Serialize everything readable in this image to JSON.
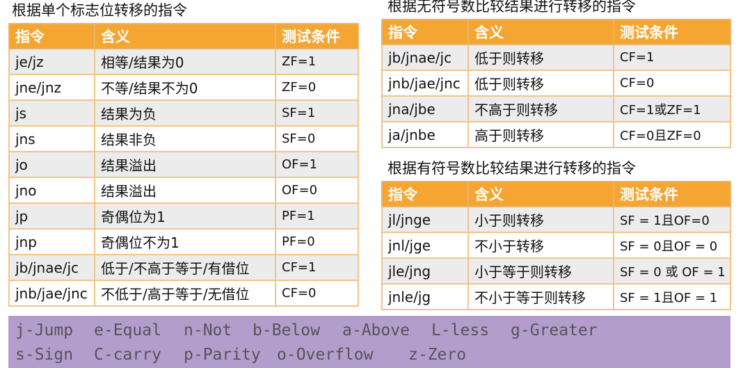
{
  "left": {
    "title": "根据单个标志位转移的指令",
    "headers": [
      "指令",
      "含义",
      "测试条件"
    ],
    "rows": [
      [
        "je/jz",
        "相等/结果为0",
        "ZF=1"
      ],
      [
        "jne/jnz",
        "不等/结果不为0",
        "ZF=0"
      ],
      [
        "js",
        "结果为负",
        "SF=1"
      ],
      [
        "jns",
        "结果非负",
        "SF=0"
      ],
      [
        "jo",
        "结果溢出",
        "OF=1"
      ],
      [
        "jno",
        "结果溢出",
        "OF=0"
      ],
      [
        "jp",
        "奇偶位为1",
        "PF=1"
      ],
      [
        "jnp",
        "奇偶位不为1",
        "PF=0"
      ],
      [
        "jb/jnae/jc",
        "低于/不高于等于/有借位",
        "CF=1"
      ],
      [
        "jnb/jae/jnc",
        "不低于/高于等于/无借位",
        "CF=0"
      ]
    ]
  },
  "unsigned": {
    "title": "根据无符号数比较结果进行转移的指令",
    "headers": [
      "指令",
      "含义",
      "测试条件"
    ],
    "rows": [
      [
        "jb/jnae/jc",
        "低于则转移",
        "CF=1"
      ],
      [
        "jnb/jae/jnc",
        "低于则转移",
        "CF=0"
      ],
      [
        "jna/jbe",
        "不高于则转移",
        "CF=1或ZF=1"
      ],
      [
        "ja/jnbe",
        "高于则转移",
        "CF=0且ZF=0"
      ]
    ]
  },
  "signed": {
    "title": "根据有符号数比较结果进行转移的指令",
    "headers": [
      "指令",
      "含义",
      "测试条件"
    ],
    "rows": [
      [
        "jl/jnge",
        "小于则转移",
        "SF = 1且OF=0"
      ],
      [
        "jnl/jge",
        "不小于转移",
        "SF = 0且OF = 0"
      ],
      [
        "jle/jng",
        "小于等于则转移",
        "SF = 0 或 OF = 1"
      ],
      [
        "jnle/jg",
        "不小于等于则转移",
        "SF = 1且OF = 1"
      ]
    ]
  },
  "legend": {
    "line1": [
      "j-Jump",
      "e-Equal",
      "n-Not",
      "b-Below",
      "a-Above",
      "L-less",
      "g-Greater"
    ],
    "line2": [
      "s-Sign",
      "C-carry",
      "p-Parity",
      "o-Overflow",
      "z-Zero"
    ]
  },
  "colors": {
    "header_bg": "#f5a531",
    "border": "#e39b3b",
    "row_alt": "#ececec",
    "legend_bg": "#b39dcd",
    "legend_text": "#555555"
  }
}
